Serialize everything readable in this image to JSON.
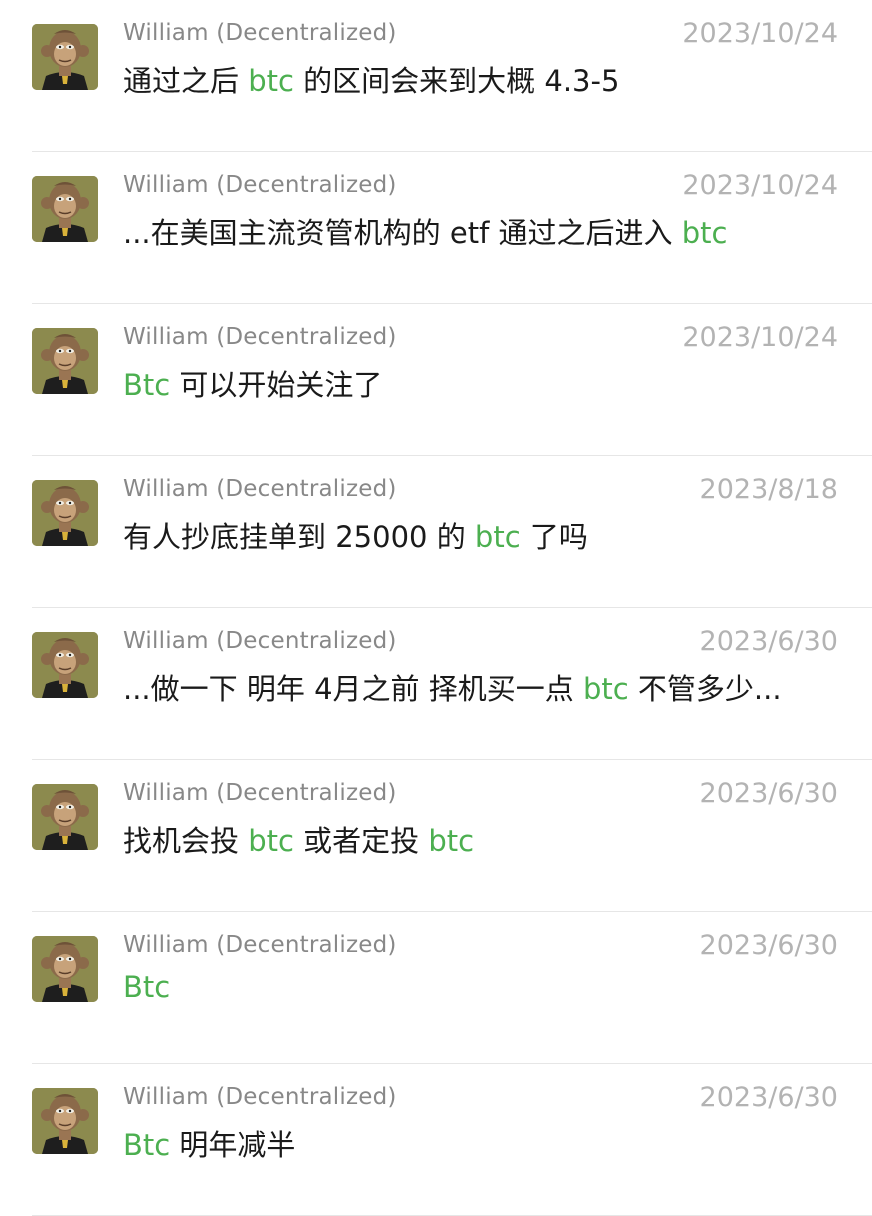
{
  "results": [
    {
      "sender": "William (Decentralized)",
      "date": "2023/10/24",
      "segments": [
        {
          "text": "通过之后 ",
          "hl": false
        },
        {
          "text": "btc",
          "hl": true
        },
        {
          "text": " 的区间会来到大概 4.3-5",
          "hl": false
        }
      ]
    },
    {
      "sender": "William (Decentralized)",
      "date": "2023/10/24",
      "segments": [
        {
          "text": "...在美国主流资管机构的 etf 通过之后进入 ",
          "hl": false
        },
        {
          "text": "btc",
          "hl": true
        }
      ]
    },
    {
      "sender": "William (Decentralized)",
      "date": "2023/10/24",
      "segments": [
        {
          "text": "Btc",
          "hl": true
        },
        {
          "text": " 可以开始关注了",
          "hl": false
        }
      ]
    },
    {
      "sender": "William (Decentralized)",
      "date": "2023/8/18",
      "segments": [
        {
          "text": "有人抄底挂单到 25000 的 ",
          "hl": false
        },
        {
          "text": "btc",
          "hl": true
        },
        {
          "text": " 了吗",
          "hl": false
        }
      ]
    },
    {
      "sender": "William (Decentralized)",
      "date": "2023/6/30",
      "segments": [
        {
          "text": "...做一下 明年 4月之前 择机买一点 ",
          "hl": false
        },
        {
          "text": "btc",
          "hl": true
        },
        {
          "text": " 不管多少...",
          "hl": false
        }
      ]
    },
    {
      "sender": "William (Decentralized)",
      "date": "2023/6/30",
      "segments": [
        {
          "text": "找机会投 ",
          "hl": false
        },
        {
          "text": "btc",
          "hl": true
        },
        {
          "text": " 或者定投 ",
          "hl": false
        },
        {
          "text": "btc",
          "hl": true
        }
      ]
    },
    {
      "sender": "William (Decentralized)",
      "date": "2023/6/30",
      "segments": [
        {
          "text": "Btc",
          "hl": true
        }
      ]
    },
    {
      "sender": "William (Decentralized)",
      "date": "2023/6/30",
      "segments": [
        {
          "text": "Btc",
          "hl": true
        },
        {
          "text": " 明年减半",
          "hl": false
        }
      ]
    }
  ],
  "colors": {
    "highlight": "#4caf50",
    "sender": "#888888",
    "date": "#b3b3b3",
    "message": "#1a1a1a",
    "avatar_bg": "#8c8a4e"
  },
  "icons": {
    "avatar": "ape-avatar-icon"
  }
}
